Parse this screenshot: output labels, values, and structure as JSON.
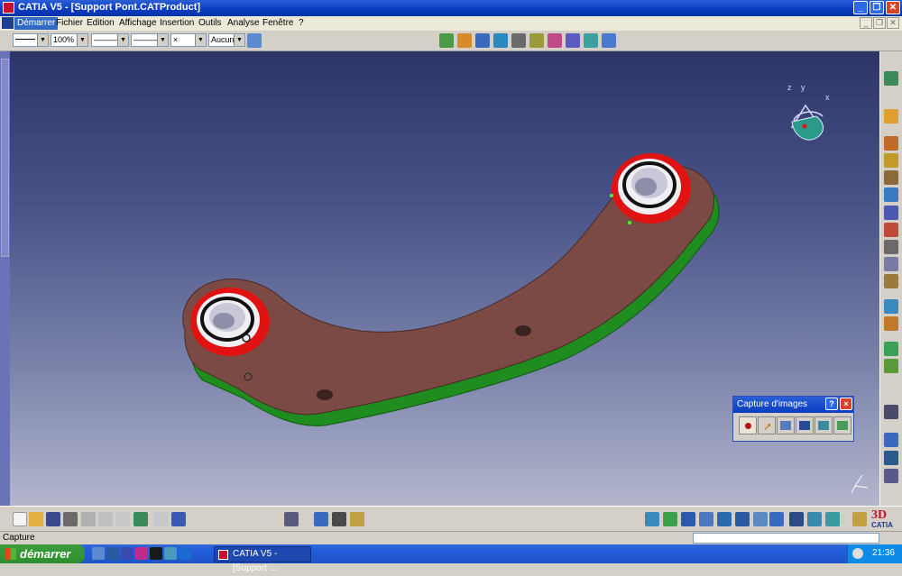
{
  "window": {
    "title": "CATIA V5 - [Support Pont.CATProduct]"
  },
  "menu": {
    "items": [
      "Démarrer",
      "Fichier",
      "Edition",
      "Affichage",
      "Insertion",
      "Outils",
      "Analyse",
      "Fenêtre",
      "?"
    ]
  },
  "toolbar": {
    "color_value": "",
    "transparency_value": "100%",
    "linetype_value": "———",
    "thickness_value": "———",
    "point_value": "×",
    "layer_value": "Aucun"
  },
  "compass": {
    "z_label": "z",
    "y_label": "y",
    "x_label": "x"
  },
  "capture_panel": {
    "title": "Capture d'images",
    "help_label": "?",
    "close_label": "×"
  },
  "status": {
    "text": "Capture"
  },
  "taskbar": {
    "start_label": "démarrer",
    "task_label": "CATIA V5 - [Support ...",
    "clock": "21:36"
  },
  "logo": {
    "text": "CATIA"
  },
  "colors": {
    "part_body": "#7c4a44",
    "part_base": "#1e8c1e",
    "ring": "#e01212",
    "viewport_top": "#2d3568",
    "viewport_bottom": "#b3b6cc"
  }
}
